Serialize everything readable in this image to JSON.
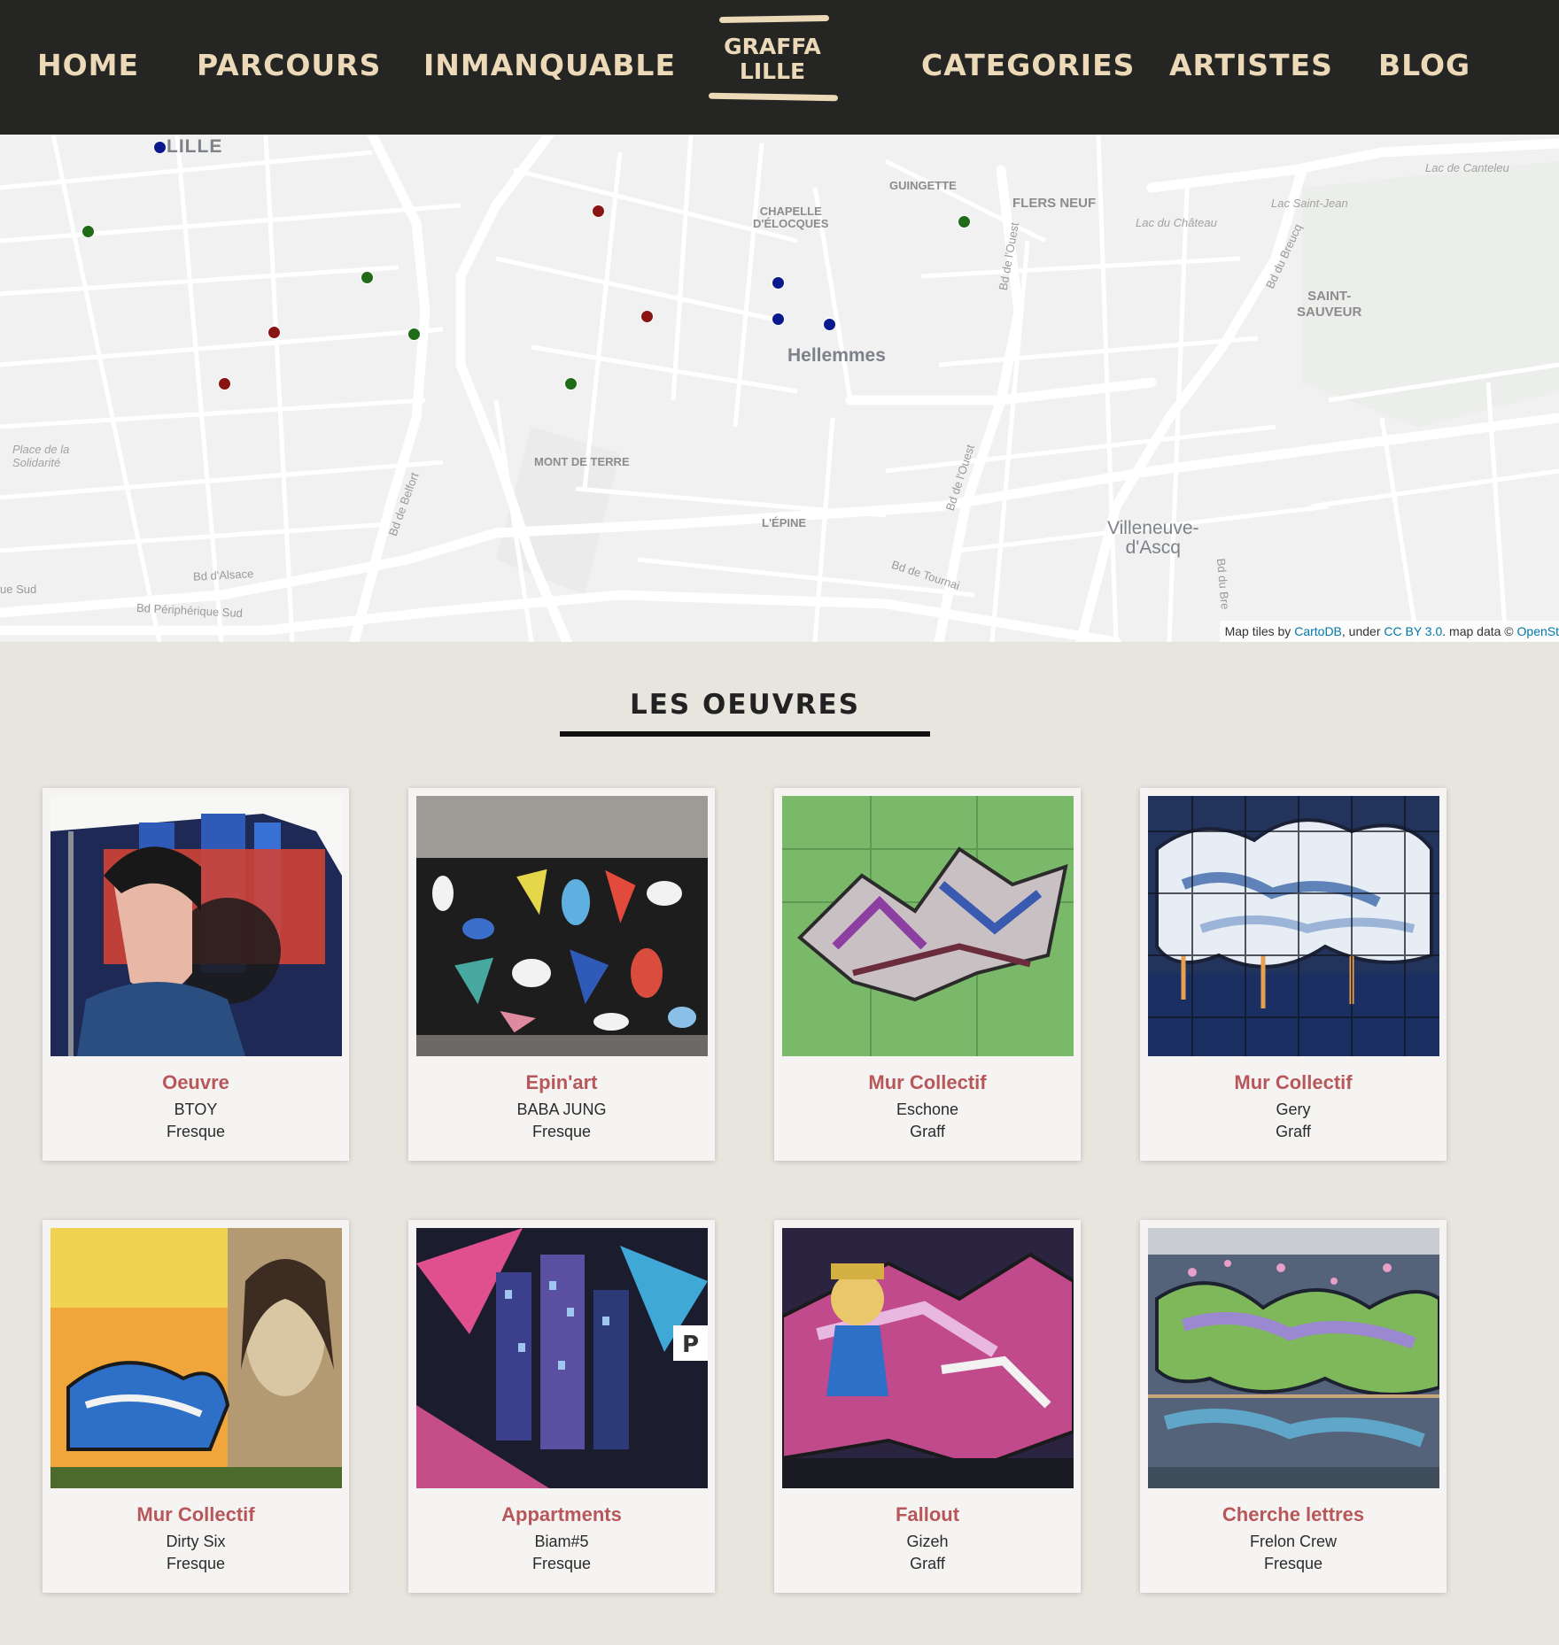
{
  "nav": {
    "left": [
      "HOME",
      "PARCOURS",
      "INMANQUABLE"
    ],
    "right": [
      "CATEGORIES",
      "ARTISTES",
      "BLOG"
    ]
  },
  "logo": {
    "line1": "GRAFFA",
    "line2": "LILLE"
  },
  "map": {
    "labels": {
      "lille": "LILLE",
      "hellemmes": "Hellemmes",
      "villeneuve": "Villeneuve-\nd'Ascq",
      "chapelle": "CHAPELLE\nD'ÉLOCQUES",
      "guinguette": "GUINGETTE",
      "flers": "FLERS NEUF",
      "saint_sauveur": "SAINT-\nSAUVEUR",
      "mont_de_terre": "MONT DE TERRE",
      "epine": "L'ÉPINE",
      "lac_canteleu": "Lac de Canteleu",
      "lac_saint_jean": "Lac Saint-Jean",
      "lac_chateau": "Lac du Château",
      "place_solidarite": "Place de la\nSolidarité",
      "bd_alsace": "Bd d'Alsace",
      "bd_peripherique": "Bd Périphérique Sud",
      "bd_sud": "ue Sud",
      "bd_belfort": "Bd de Belfort",
      "bd_ouest": "Bd de l'Ouest",
      "bd_ouest2": "Bd de l'Ouest",
      "bd_tournai": "Bd de Tournai",
      "bd_breucq": "Bd du Breucq",
      "bd_breucq2": "Bd du Bre"
    },
    "marker_colors": {
      "blue": "#0a1a8c",
      "red": "#8a1414",
      "green": "#1f6b18"
    },
    "markers": [
      {
        "color": "blue"
      },
      {
        "color": "green"
      },
      {
        "color": "green"
      },
      {
        "color": "red"
      },
      {
        "color": "green"
      },
      {
        "color": "red"
      },
      {
        "color": "red"
      },
      {
        "color": "green"
      },
      {
        "color": "red"
      },
      {
        "color": "blue"
      },
      {
        "color": "blue"
      },
      {
        "color": "blue"
      },
      {
        "color": "green"
      }
    ],
    "attribution": {
      "prefix": "Map tiles by ",
      "cartodb": "CartoDB",
      "under": ", under ",
      "license": "CC BY 3.0",
      "mapdata": ". map data © ",
      "osm": "OpenSt"
    }
  },
  "section": {
    "title": "LES OEUVRES"
  },
  "accent_color": "#b8575a",
  "cards": [
    {
      "title": "Oeuvre",
      "artist": "BTOY",
      "type": "Fresque",
      "image": "woman-portrait-mural"
    },
    {
      "title": "Epin'art",
      "artist": "BABA JUNG",
      "type": "Fresque",
      "image": "mosaic-mural"
    },
    {
      "title": "Mur Collectif",
      "artist": "Eschone",
      "type": "Graff",
      "image": "green-wall-graffiti"
    },
    {
      "title": "Mur Collectif",
      "artist": "Gery",
      "type": "Graff",
      "image": "cloud-fence-graffiti"
    },
    {
      "title": "Mur Collectif",
      "artist": "Dirty Six",
      "type": "Fresque",
      "image": "orange-city-graffiti"
    },
    {
      "title": "Appartments",
      "artist": "Biam#5",
      "type": "Fresque",
      "image": "night-city-mural"
    },
    {
      "title": "Fallout",
      "artist": "Gizeh",
      "type": "Graff",
      "image": "fallout-graffiti"
    },
    {
      "title": "Cherche lettres",
      "artist": "Frelon Crew",
      "type": "Fresque",
      "image": "letters-graffiti"
    }
  ]
}
